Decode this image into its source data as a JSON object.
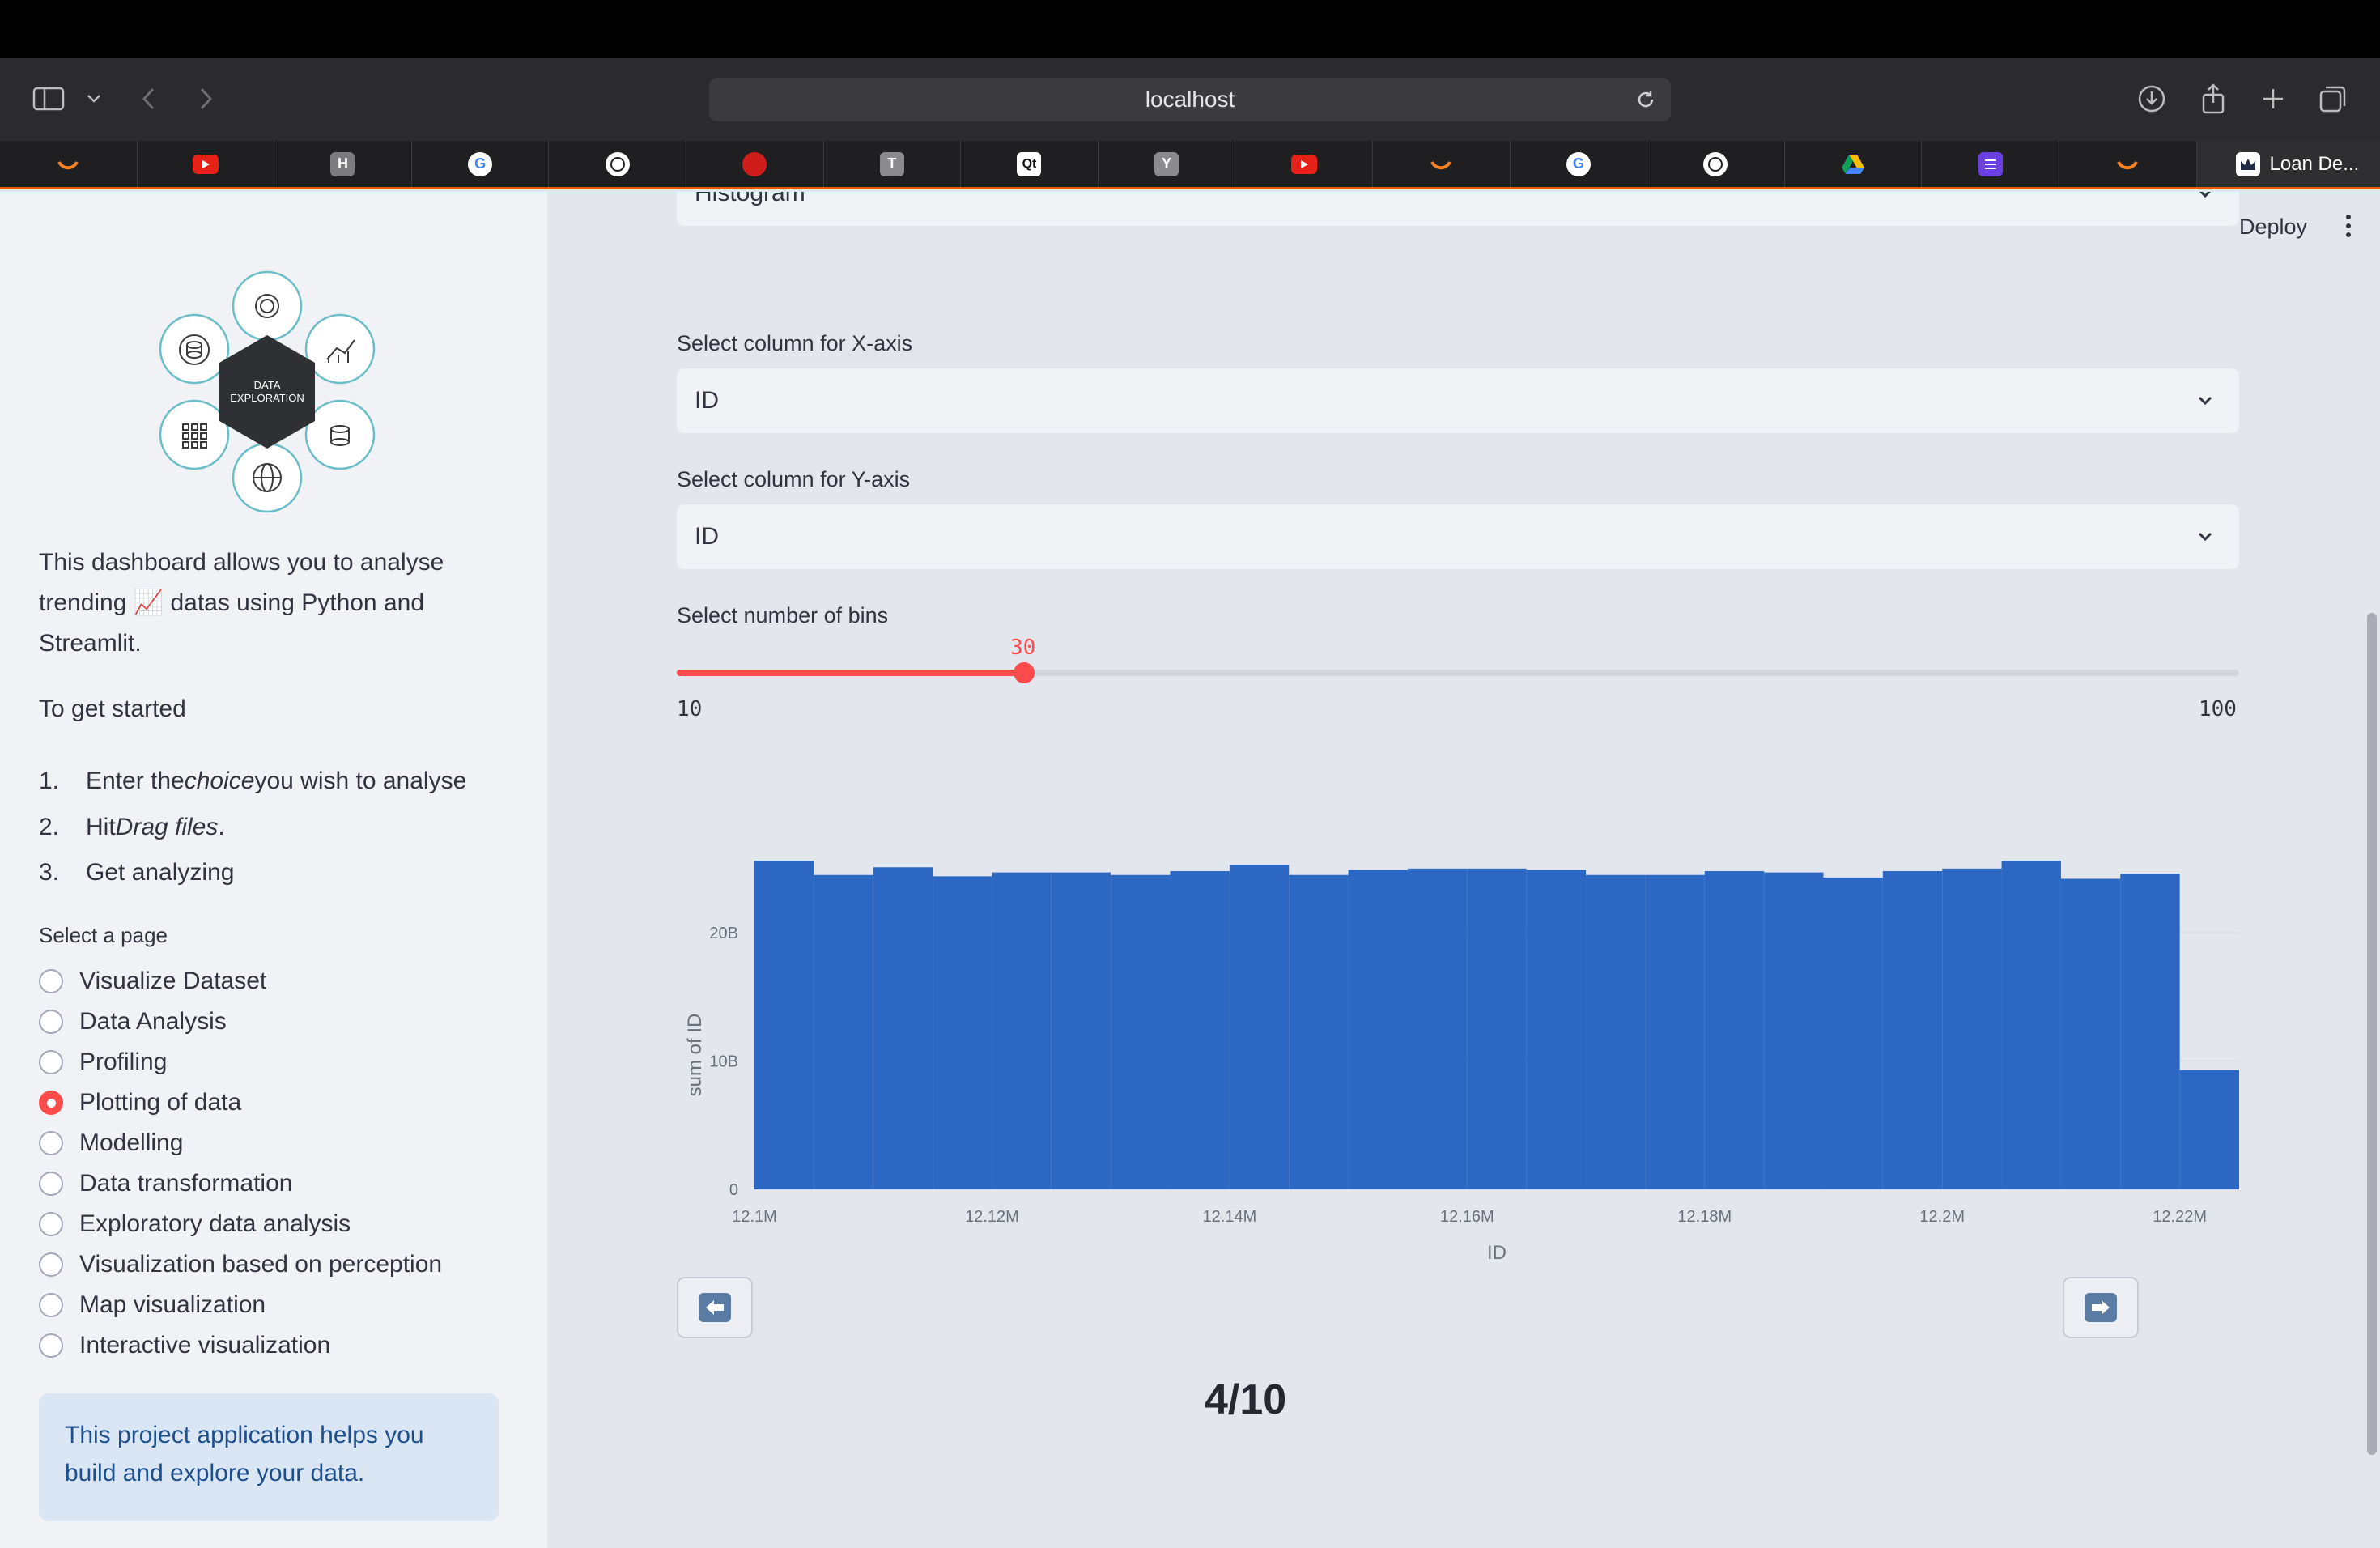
{
  "browser": {
    "url": "localhost",
    "tabs": [
      {
        "icon": "orange-arc-icon",
        "color": "#1f1f21"
      },
      {
        "icon": "youtube-icon",
        "color": "#e62117"
      },
      {
        "icon": "h-icon",
        "color": "#7b7b80"
      },
      {
        "icon": "google-icon",
        "color": "#ffffff"
      },
      {
        "icon": "openai-icon",
        "color": "#ffffff"
      },
      {
        "icon": "red-circle-icon",
        "color": "#d11c1c"
      },
      {
        "icon": "t-icon",
        "color": "#8a8a8f"
      },
      {
        "icon": "qt-icon",
        "color": "#ffffff"
      },
      {
        "icon": "y-icon",
        "color": "#8a8a8f"
      },
      {
        "icon": "youtube-icon",
        "color": "#e62117"
      },
      {
        "icon": "orange-arc-icon",
        "color": "#1f1f21"
      },
      {
        "icon": "google-icon",
        "color": "#ffffff"
      },
      {
        "icon": "chart-icon",
        "color": "#ffffff"
      },
      {
        "icon": "drive-icon",
        "color": "#1f1f21"
      },
      {
        "icon": "list-icon",
        "color": "#6c3fe0"
      },
      {
        "icon": "orange-arc-icon",
        "color": "#1f1f21"
      }
    ],
    "active_tab": {
      "icon": "crown-icon",
      "title": "Loan De..."
    }
  },
  "sidebar": {
    "logo": {
      "line1": "DATA",
      "line2": "EXPLORATION"
    },
    "intro_before": "This dashboard allows you to analyse trending ",
    "intro_emoji": "📈",
    "intro_after": " datas using Python and Streamlit.",
    "get_started": "To get started",
    "steps": [
      {
        "num": "1.",
        "pre": "Enter the ",
        "em": "choice",
        "post": " you wish to analyse"
      },
      {
        "num": "2.",
        "pre": "Hit ",
        "em": "Drag files",
        "post": "."
      },
      {
        "num": "3.",
        "pre": "Get analyzing",
        "em": "",
        "post": ""
      }
    ],
    "select_page_label": "Select a page",
    "pages": [
      {
        "label": "Visualize Dataset",
        "checked": false
      },
      {
        "label": "Data Analysis",
        "checked": false
      },
      {
        "label": "Profiling",
        "checked": false
      },
      {
        "label": "Plotting of data",
        "checked": true
      },
      {
        "label": "Modelling",
        "checked": false
      },
      {
        "label": "Data transformation",
        "checked": false
      },
      {
        "label": "Exploratory data analysis",
        "checked": false
      },
      {
        "label": "Visualization based on perception",
        "checked": false
      },
      {
        "label": "Map visualization",
        "checked": false
      },
      {
        "label": "Interactive visualization",
        "checked": false
      }
    ],
    "info": "This project application helps you build and explore your data."
  },
  "main": {
    "deploy_label": "Deploy",
    "chart_type_value": "Histogram",
    "x_axis_label": "Select column for X-axis",
    "x_axis_value": "ID",
    "y_axis_label": "Select column for Y-axis",
    "y_axis_value": "ID",
    "bins_label": "Select number of bins",
    "bins_value": "30",
    "bins_min": "10",
    "bins_max": "100",
    "page_counter": "4/10",
    "accent": "#ff4b4b"
  },
  "chart_data": {
    "type": "bar",
    "xlabel": "ID",
    "ylabel": "sum of ID",
    "x_ticks": [
      {
        "label": "12.1M",
        "value": 12100000
      },
      {
        "label": "12.12M",
        "value": 12120000
      },
      {
        "label": "12.14M",
        "value": 12140000
      },
      {
        "label": "12.16M",
        "value": 12160000
      },
      {
        "label": "12.18M",
        "value": 12180000
      },
      {
        "label": "12.2M",
        "value": 12200000
      },
      {
        "label": "12.22M",
        "value": 12220000
      }
    ],
    "y_ticks": [
      {
        "label": "0",
        "value": 0
      },
      {
        "label": "10B",
        "value": 10000000000
      },
      {
        "label": "20B",
        "value": 20000000000
      }
    ],
    "xlim": [
      12100000,
      12225000
    ],
    "ylim": [
      0,
      26000000000
    ],
    "bin_width": 5000,
    "bins": [
      {
        "x0": 12100000,
        "value": 25600000000
      },
      {
        "x0": 12105000,
        "value": 24500000000
      },
      {
        "x0": 12110000,
        "value": 25100000000
      },
      {
        "x0": 12115000,
        "value": 24400000000
      },
      {
        "x0": 12120000,
        "value": 24700000000
      },
      {
        "x0": 12125000,
        "value": 24700000000
      },
      {
        "x0": 12130000,
        "value": 24500000000
      },
      {
        "x0": 12135000,
        "value": 24800000000
      },
      {
        "x0": 12140000,
        "value": 25300000000
      },
      {
        "x0": 12145000,
        "value": 24500000000
      },
      {
        "x0": 12150000,
        "value": 24900000000
      },
      {
        "x0": 12155000,
        "value": 25000000000
      },
      {
        "x0": 12160000,
        "value": 25000000000
      },
      {
        "x0": 12165000,
        "value": 24900000000
      },
      {
        "x0": 12170000,
        "value": 24500000000
      },
      {
        "x0": 12175000,
        "value": 24500000000
      },
      {
        "x0": 12180000,
        "value": 24800000000
      },
      {
        "x0": 12185000,
        "value": 24700000000
      },
      {
        "x0": 12190000,
        "value": 24300000000
      },
      {
        "x0": 12195000,
        "value": 24800000000
      },
      {
        "x0": 12200000,
        "value": 25000000000
      },
      {
        "x0": 12205000,
        "value": 25600000000
      },
      {
        "x0": 12210000,
        "value": 24200000000
      },
      {
        "x0": 12215000,
        "value": 24600000000
      },
      {
        "x0": 12220000,
        "value": 9300000000
      }
    ],
    "bar_color": "#2c67c3",
    "grid": true
  }
}
